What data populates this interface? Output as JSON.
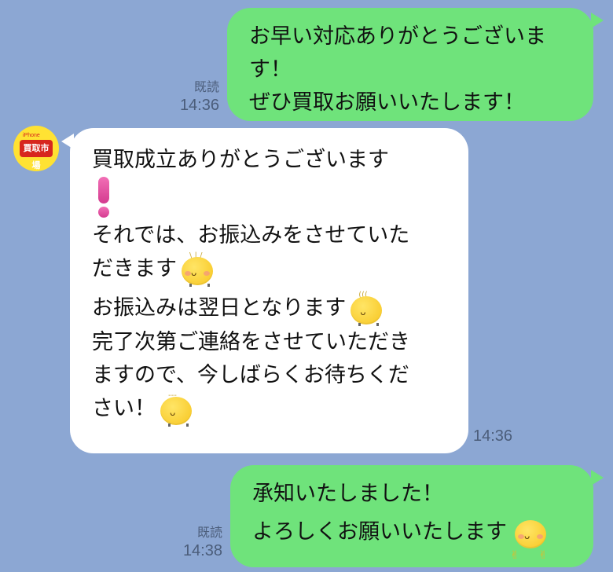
{
  "messages": {
    "msg1": {
      "lines": [
        "お早い対応ありがとうございま",
        "す！",
        "ぜひ買取お願いいたします！"
      ],
      "read": "既読",
      "time": "14:36"
    },
    "msg2": {
      "lines": [
        "買取成立ありがとうございます",
        "それでは、お振込みをさせていた",
        "だきます",
        "お振込みは翌日となります",
        "完了次第ご連絡をさせていただき",
        "ますので、今しばらくお待ちくだ",
        "さい！"
      ],
      "time": "14:36"
    },
    "msg3": {
      "lines": [
        "承知いたしました！",
        "よろしくお願いいたします"
      ],
      "read": "既読",
      "time": "14:38"
    }
  },
  "avatar": {
    "logo_top": "iPhone",
    "logo_text": "買取市場"
  },
  "icons": {
    "exclamation": "pink-exclamation-icon",
    "emoji_smile": "yellow-bird-emoji-icon",
    "emoji_peace": "peace-sign-emoji-icon"
  },
  "colors": {
    "background": "#8ca7d3",
    "sent_bubble": "#6fe37b",
    "received_bubble": "#ffffff",
    "avatar_bg": "#ffe233",
    "logo_red": "#d7261e"
  }
}
